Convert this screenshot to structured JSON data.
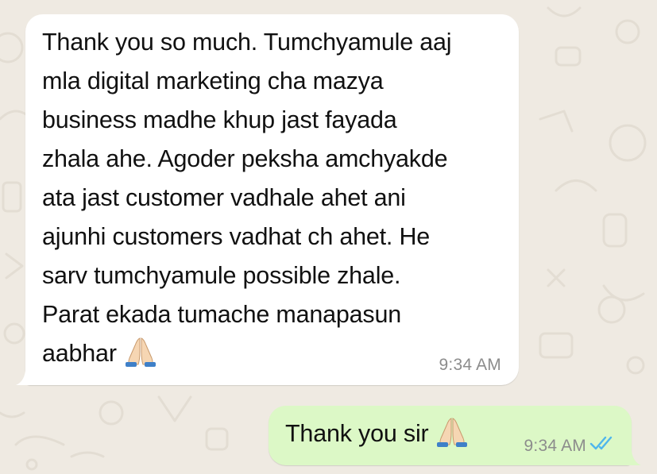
{
  "chat": {
    "messages": [
      {
        "direction": "incoming",
        "lines": [
          "Thank you so much. Tumchyamule aaj",
          "mla digital marketing cha mazya",
          "business madhe khup jast fayada",
          "zhala ahe. Agoder peksha amchyakde",
          "ata jast customer vadhale ahet ani",
          "ajunhi customers vadhat ch ahet. He",
          "sarv tumchyamule possible zhale.",
          "Parat ekada tumache manapasun",
          "aabhar"
        ],
        "emoji": "folded-hands-icon",
        "time": "9:34 AM"
      },
      {
        "direction": "outgoing",
        "text": "Thank you sir",
        "emoji": "folded-hands-icon",
        "time": "9:34 AM",
        "status": "read-double-check-icon"
      }
    ]
  },
  "colors": {
    "wallpaper": "#efeae2",
    "incoming_bubble": "#ffffff",
    "outgoing_bubble": "#dcf8c6",
    "text": "#111111",
    "timestamp": "#8c8c8c",
    "read_ticks": "#4fb6ec"
  }
}
